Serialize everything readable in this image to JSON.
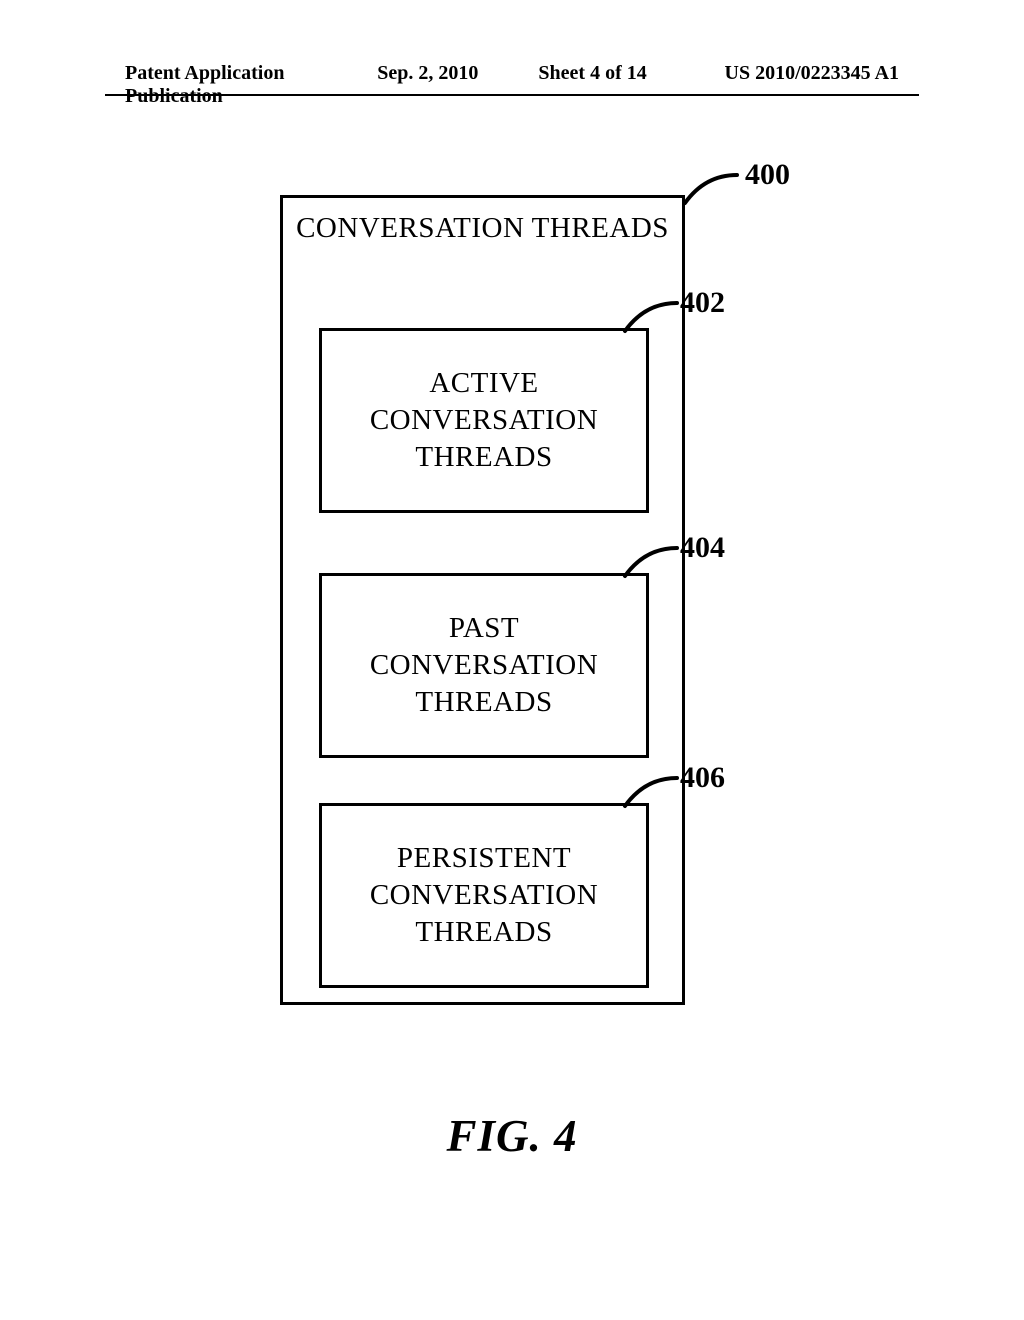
{
  "header": {
    "type": "Patent Application Publication",
    "date": "Sep. 2, 2010",
    "sheet": "Sheet 4 of 14",
    "pubno": "US 2010/0223345 A1"
  },
  "figure": {
    "caption": "FIG. 4",
    "outer": {
      "ref": "400",
      "title": "CONVERSATION THREADS"
    },
    "boxes": [
      {
        "ref": "402",
        "line1": "ACTIVE",
        "line2": "CONVERSATION",
        "line3": "THREADS"
      },
      {
        "ref": "404",
        "line1": "PAST",
        "line2": "CONVERSATION",
        "line3": "THREADS"
      },
      {
        "ref": "406",
        "line1": "PERSISTENT",
        "line2": "CONVERSATION",
        "line3": "THREADS"
      }
    ]
  }
}
